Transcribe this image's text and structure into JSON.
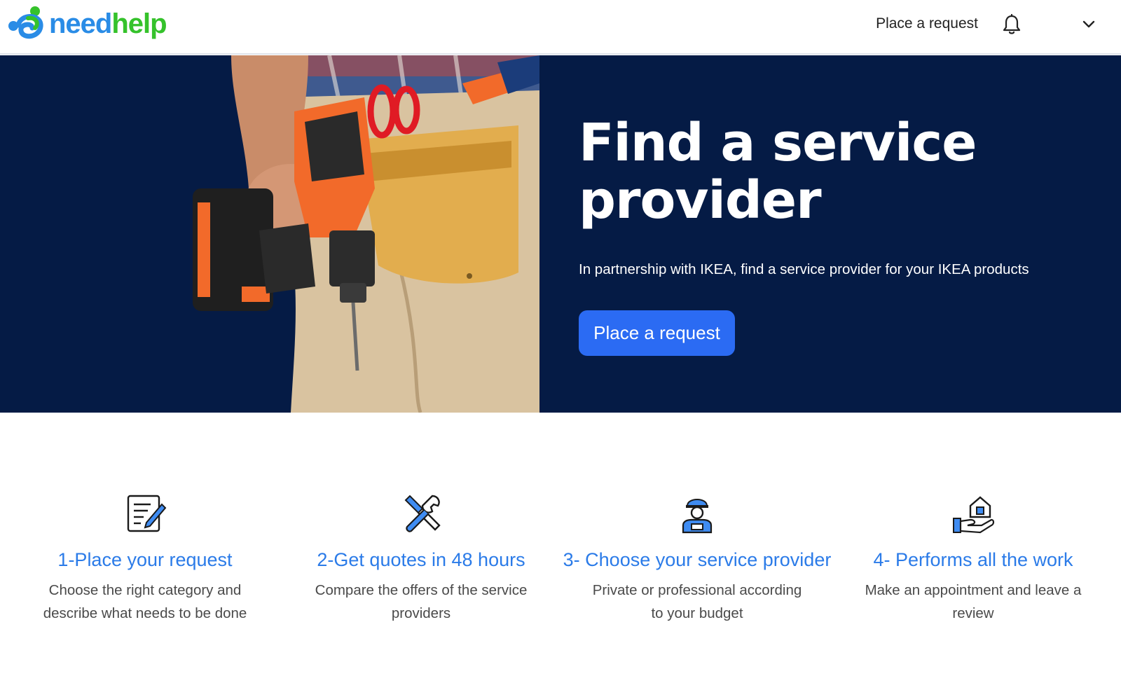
{
  "header": {
    "logo_need": "need",
    "logo_help": "help",
    "nav_place_request": "Place a request",
    "icons": [
      "needhelp-logo-icon",
      "bell-icon",
      "chevron-down-icon"
    ]
  },
  "hero": {
    "title": "Find a service provider",
    "subtitle": "In partnership with IKEA, find a service provider for your IKEA products",
    "cta_label": "Place a request",
    "background_color": "#051b45",
    "button_color": "#2b6bf3"
  },
  "steps": [
    {
      "icon": "form-edit-icon",
      "title": "1-Place your request",
      "description": "Choose the right category and describe what needs to be done"
    },
    {
      "icon": "tools-icon",
      "title": "2-Get quotes in 48 hours",
      "description": "Compare the offers of the service providers"
    },
    {
      "icon": "worker-icon",
      "title": "3- Choose your service provider",
      "description": "Private or professional according to your budget"
    },
    {
      "icon": "home-hand-icon",
      "title": "4- Performs all the work",
      "description": "Make an appointment and leave a review"
    }
  ],
  "colors": {
    "accent_blue": "#2b7be8",
    "logo_blue": "#2a8ce6",
    "logo_green": "#35c22b"
  }
}
